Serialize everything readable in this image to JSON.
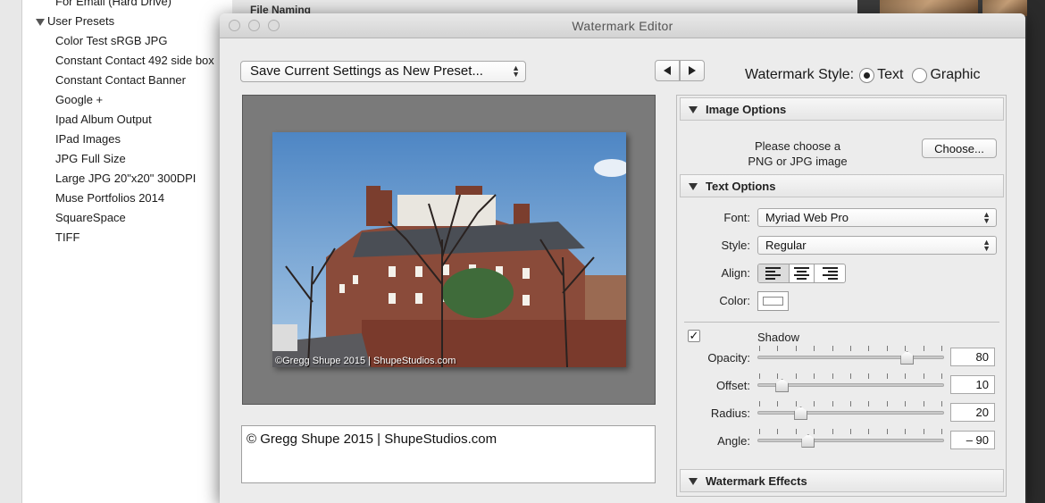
{
  "background": {
    "list_items_top": "For Email (Hard Drive)",
    "user_presets_label": "User Presets",
    "presets": [
      "Color Test sRGB JPG",
      "Constant Contact 492 side box",
      "Constant Contact Banner",
      "Google +",
      "Ipad Album Output",
      "IPad Images",
      "JPG Full Size",
      "Large JPG 20\"x20\" 300DPI",
      "Muse Portfolios 2014",
      "SquareSpace",
      "TIFF"
    ],
    "section_behind": "File Naming"
  },
  "window": {
    "title": "Watermark Editor"
  },
  "toolbar": {
    "preset_label": "Save Current Settings as New Preset...",
    "watermark_style_label": "Watermark Style:",
    "style_text": "Text",
    "style_graphic": "Graphic",
    "selected_style": "Text"
  },
  "preview": {
    "watermark_text": "©Gregg Shupe 2015 | ShupeStudios.com"
  },
  "text_input": {
    "value": "© Gregg Shupe 2015 | ShupeStudios.com"
  },
  "image_options": {
    "title": "Image Options",
    "message_line1": "Please choose a",
    "message_line2": "PNG or JPG image",
    "choose_label": "Choose..."
  },
  "text_options": {
    "title": "Text Options",
    "font_label": "Font:",
    "font_value": "Myriad Web Pro",
    "style_label": "Style:",
    "style_value": "Regular",
    "align_label": "Align:",
    "align_selected": "left",
    "color_label": "Color:",
    "color_value": "#ffffff"
  },
  "shadow": {
    "enabled": true,
    "checkmark": "✓",
    "title": "Shadow",
    "opacity_label": "Opacity:",
    "opacity_value": "80",
    "offset_label": "Offset:",
    "offset_value": "10",
    "radius_label": "Radius:",
    "radius_value": "20",
    "angle_label": "Angle:",
    "angle_value": "– 90",
    "opacity_level": 0.8,
    "offset_level": 0.13,
    "radius_level": 0.23,
    "angle_level": 0.27
  },
  "watermark_effects": {
    "title": "Watermark Effects"
  }
}
